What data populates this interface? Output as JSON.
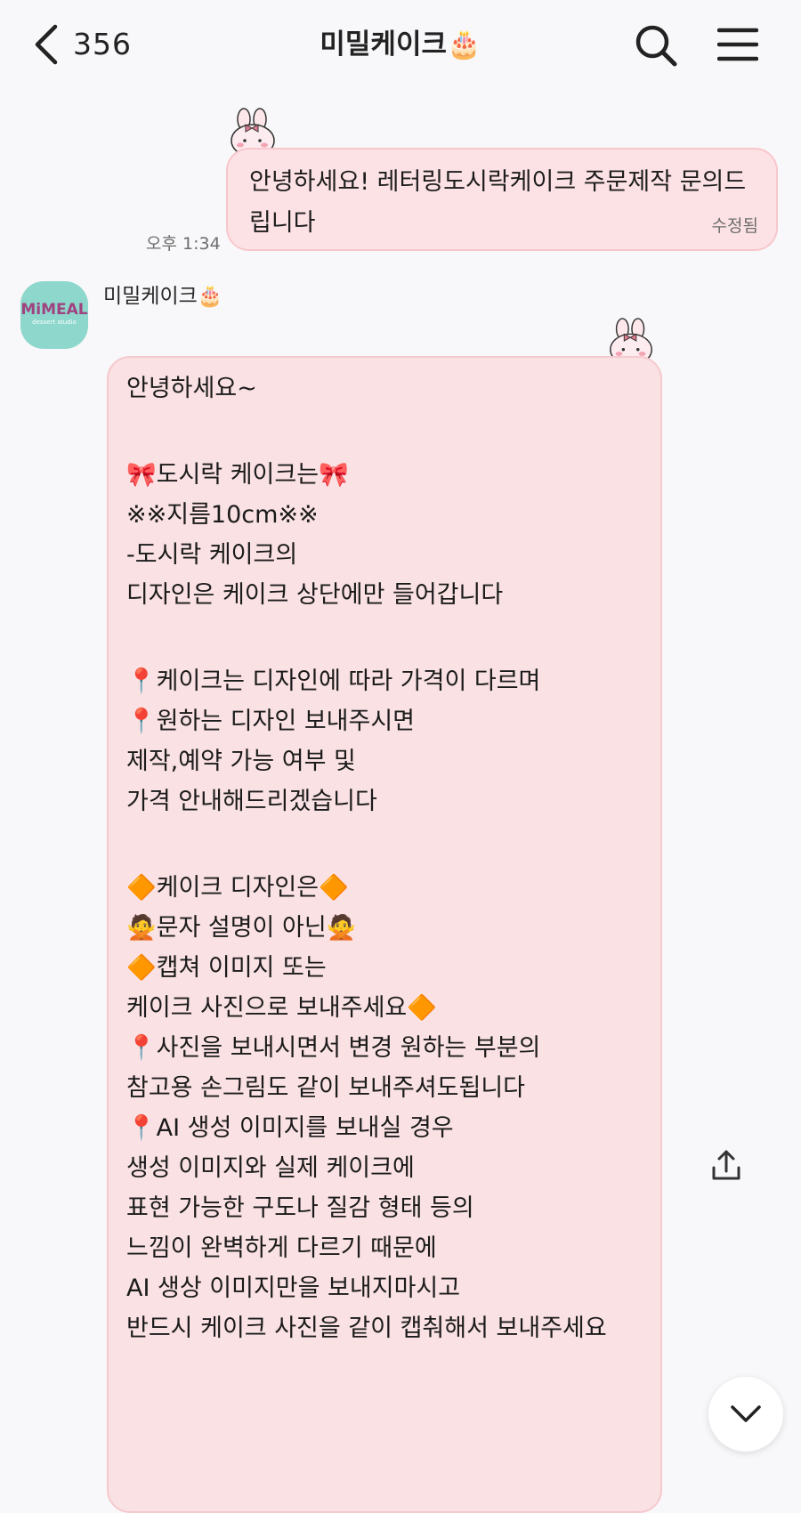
{
  "header": {
    "unread_count": "356",
    "chat_title": "미밀케이크🎂"
  },
  "messages": {
    "outgoing": {
      "text": "안녕하세요! 레터링도시락케이크 주문제작 문의드립니다",
      "edited_label": "수정됨",
      "time": "오후 1:34"
    },
    "incoming": {
      "sender_name": "미밀케이크🎂",
      "avatar_logo": "MiMEAL",
      "avatar_sub": "dessert studio",
      "lines": [
        "안녕하세요~",
        "",
        "🎀도시락 케이크는🎀",
        "※※지름10cm※※",
        "-도시락 케이크의",
        "디자인은 케이크 상단에만 들어갑니다",
        "",
        "📍케이크는 디자인에 따라 가격이 다르며",
        "📍원하는 디자인 보내주시면",
        "제작,예약 가능 여부 및",
        "가격 안내해드리겠습니다",
        "",
        "🔶케이크 디자인은🔶",
        "🙅문자 설명이 아닌🙅",
        "🔶캡쳐 이미지 또는",
        "케이크 사진으로 보내주세요🔶",
        "📍사진을 보내시면서 변경 원하는 부분의",
        "참고용 손그림도 같이 보내주셔도됩니다",
        "📍AI 생성 이미지를 보내실 경우",
        "생성 이미지와 실제 케이크에",
        "표현 가능한 구도나 질감 형태 등의",
        "느낌이 완벽하게 다르기 때문에",
        "AI 생상 이미지만을 보내지마시고",
        "반드시 케이크 사진을 같이 캡춰해서 보내주세요"
      ]
    }
  },
  "colors": {
    "bubble_bg": "#fae1e3",
    "bubble_border": "#f5c9cd",
    "page_bg": "#f8f7f9",
    "avatar_bg": "#8dd7cc"
  },
  "icons": [
    "back-chevron-icon",
    "search-icon",
    "menu-icon",
    "bunny-sticker-icon",
    "share-icon",
    "chevron-down-icon"
  ]
}
